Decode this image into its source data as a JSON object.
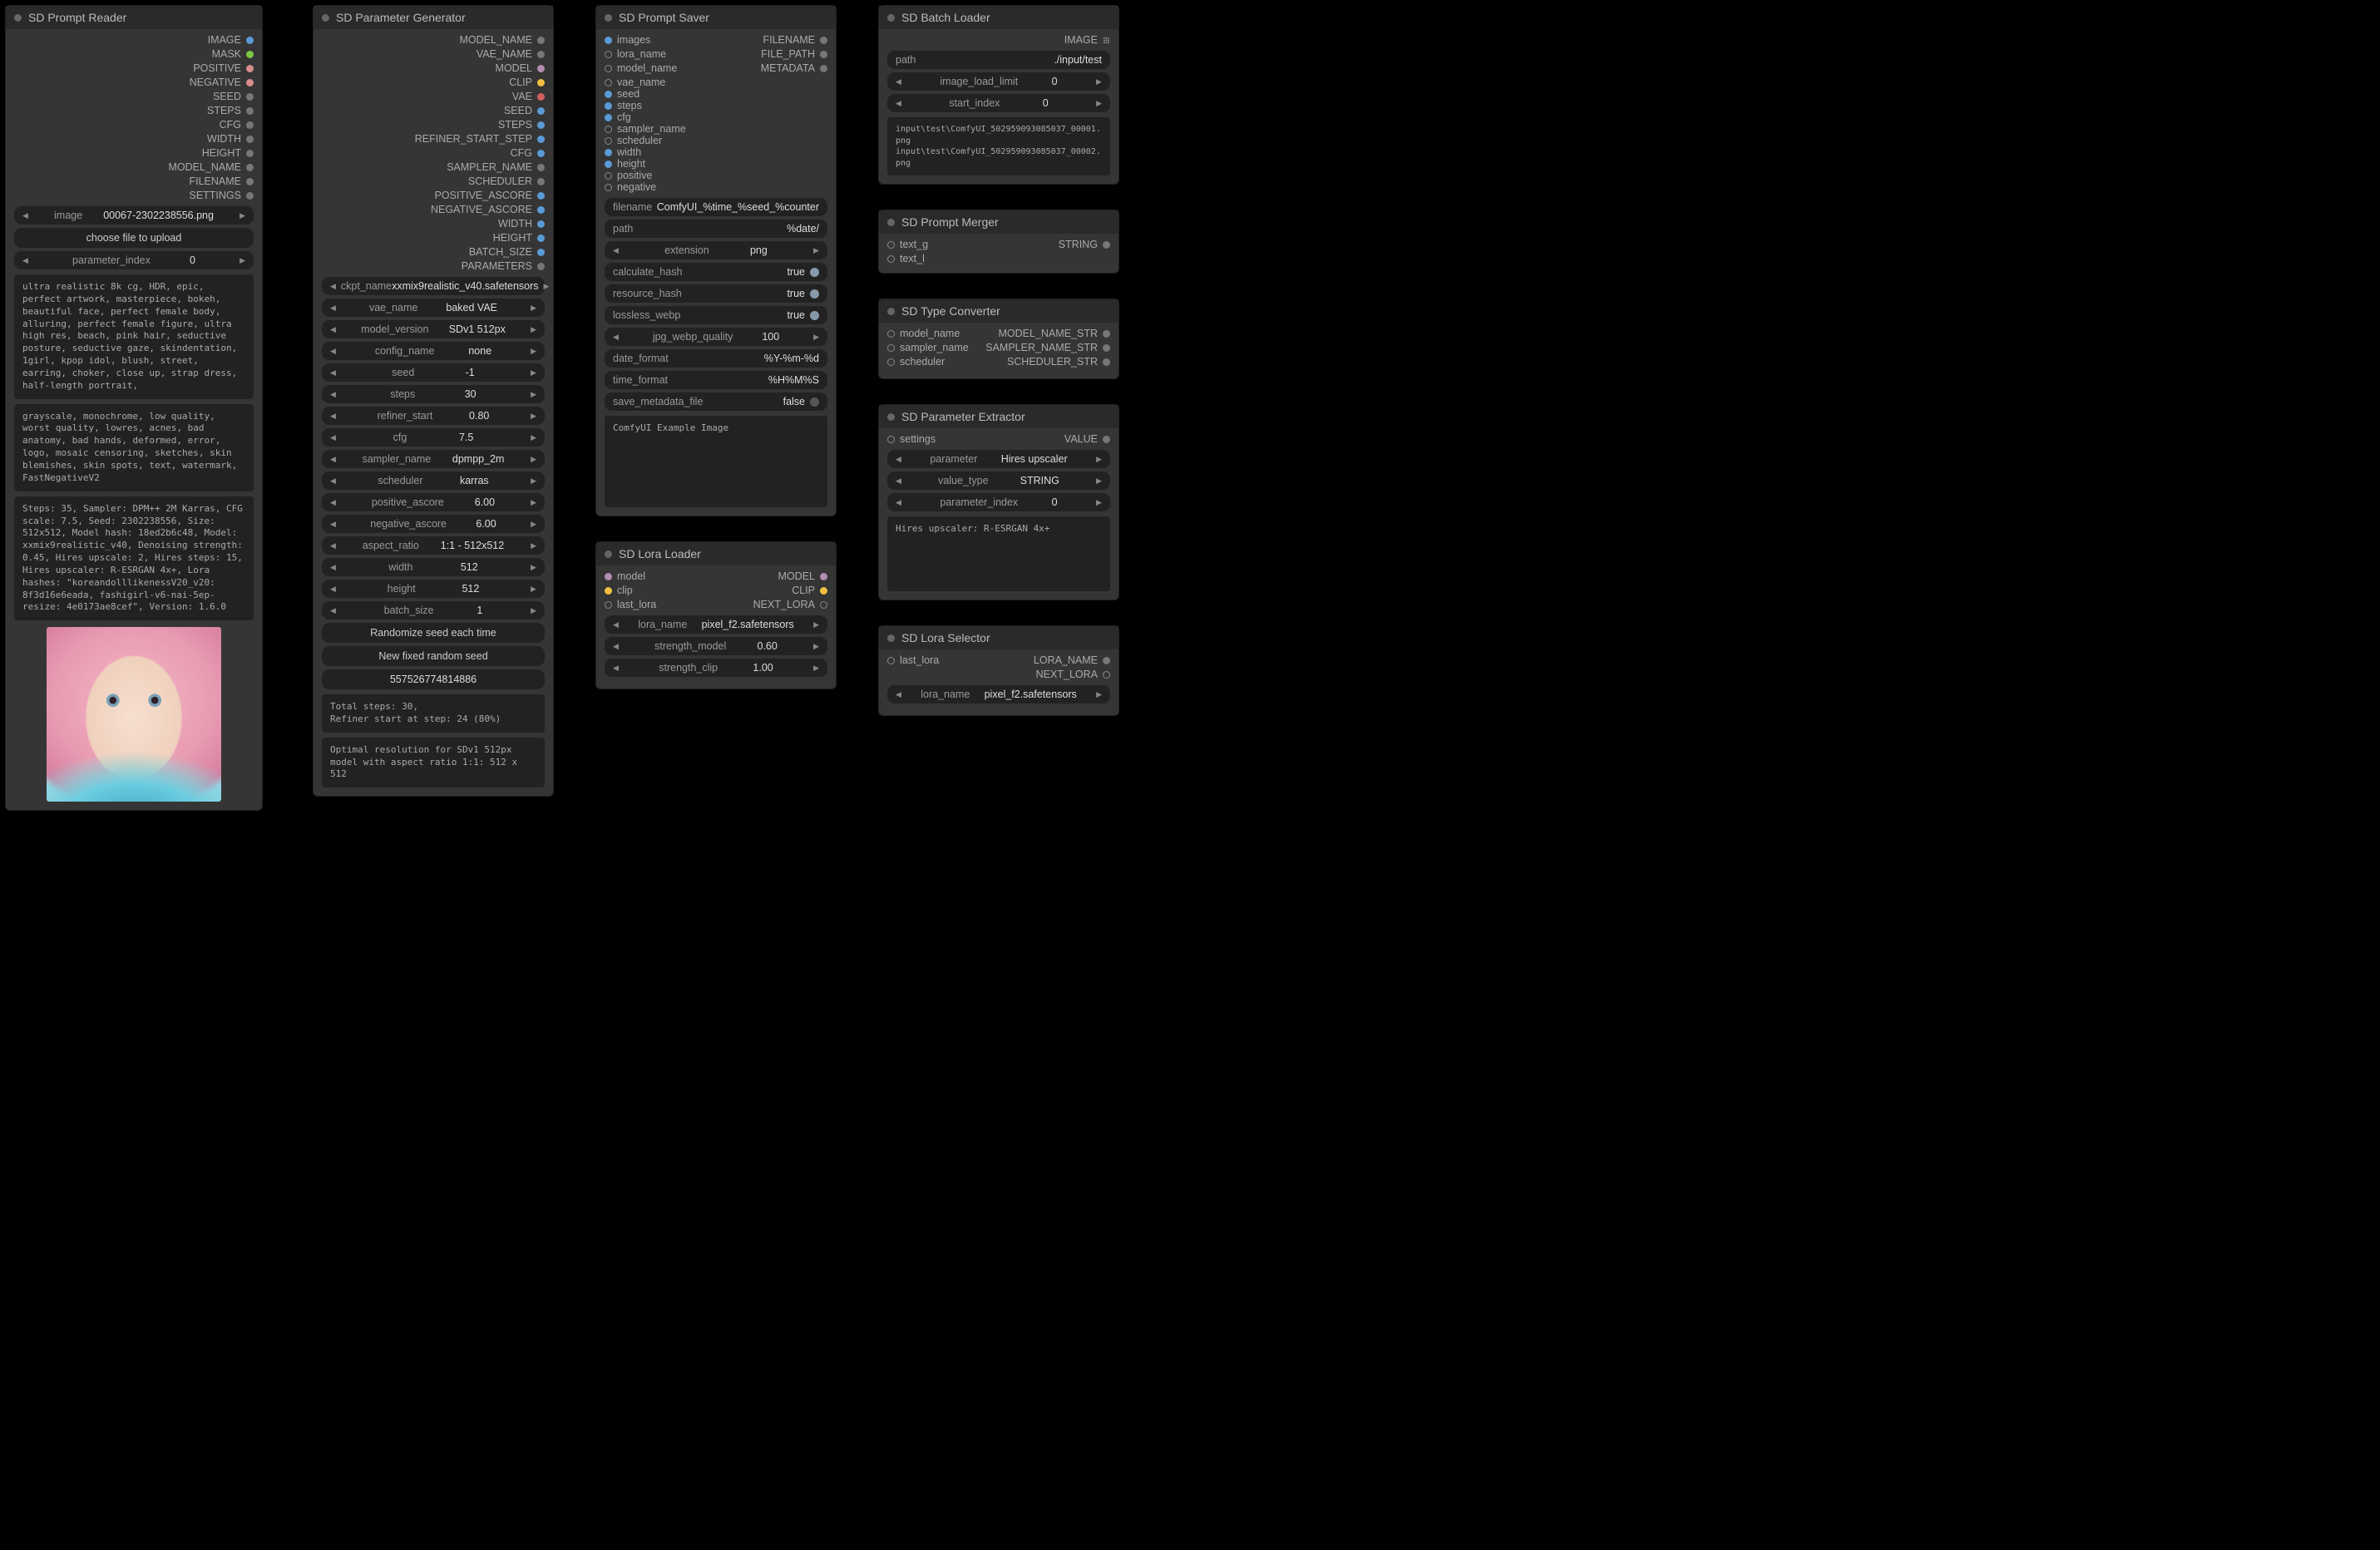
{
  "reader": {
    "title": "SD Prompt Reader",
    "outs": [
      "IMAGE",
      "MASK",
      "POSITIVE",
      "NEGATIVE",
      "SEED",
      "STEPS",
      "CFG",
      "WIDTH",
      "HEIGHT",
      "MODEL_NAME",
      "FILENAME",
      "SETTINGS"
    ],
    "image_widget": {
      "label": "image",
      "value": "00067-2302238556.png"
    },
    "upload_btn": "choose file to upload",
    "param_index": {
      "label": "parameter_index",
      "value": "0"
    },
    "positive": "ultra realistic 8k cg, HDR, epic, perfect artwork, masterpiece, bokeh, beautiful face, perfect female body, alluring, perfect female figure, ultra high res, beach, pink hair, seductive posture, seductive gaze, skindentation, 1girl, kpop idol, blush, street, earring, choker, close up, strap dress, half-length portrait,",
    "negative": "grayscale, monochrome, low quality, worst quality, lowres, acnes, bad anatomy, bad hands, deformed, error, logo, mosaic censoring, sketches, skin blemishes, skin spots, text, watermark, FastNegativeV2",
    "settings": "Steps: 35, Sampler: DPM++ 2M Karras, CFG scale: 7.5, Seed: 2302238556, Size: 512x512, Model hash: 18ed2b6c48, Model: xxmix9realistic_v40, Denoising strength: 0.45, Hires upscale: 2, Hires steps: 15, Hires upscaler: R-ESRGAN 4x+, Lora hashes: \"koreandolllikenessV20_v20: 8f3d16e6eada, fashigirl-v6-nai-5ep-resize: 4e0173ae8cef\", Version: 1.6.0"
  },
  "paramgen": {
    "title": "SD Parameter Generator",
    "outs": [
      "MODEL_NAME",
      "VAE_NAME",
      "MODEL",
      "CLIP",
      "VAE",
      "SEED",
      "STEPS",
      "REFINER_START_STEP",
      "CFG",
      "SAMPLER_NAME",
      "SCHEDULER",
      "POSITIVE_ASCORE",
      "NEGATIVE_ASCORE",
      "WIDTH",
      "HEIGHT",
      "BATCH_SIZE",
      "PARAMETERS"
    ],
    "widgets": [
      {
        "k": "ckpt_name",
        "v": "xxmix9realistic_v40.safetensors"
      },
      {
        "k": "vae_name",
        "v": "baked VAE"
      },
      {
        "k": "model_version",
        "v": "SDv1 512px"
      },
      {
        "k": "config_name",
        "v": "none"
      },
      {
        "k": "seed",
        "v": "-1"
      },
      {
        "k": "steps",
        "v": "30"
      },
      {
        "k": "refiner_start",
        "v": "0.80"
      },
      {
        "k": "cfg",
        "v": "7.5"
      },
      {
        "k": "sampler_name",
        "v": "dpmpp_2m"
      },
      {
        "k": "scheduler",
        "v": "karras"
      },
      {
        "k": "positive_ascore",
        "v": "6.00"
      },
      {
        "k": "negative_ascore",
        "v": "6.00"
      },
      {
        "k": "aspect_ratio",
        "v": "1:1 - 512x512"
      },
      {
        "k": "width",
        "v": "512"
      },
      {
        "k": "height",
        "v": "512"
      },
      {
        "k": "batch_size",
        "v": "1"
      }
    ],
    "btn1": "Randomize seed each time",
    "btn2": "New fixed random seed",
    "seed_disp": "557526774814886",
    "info1": "Total steps: 30,\nRefiner start at step: 24 (80%)",
    "info2": "Optimal resolution for SDv1 512px model with aspect ratio 1:1: 512 x 512"
  },
  "saver": {
    "title": "SD Prompt Saver",
    "ins": [
      "images",
      "lora_name",
      "model_name",
      "vae_name",
      "seed",
      "steps",
      "cfg",
      "sampler_name",
      "scheduler",
      "width",
      "height",
      "positive",
      "negative"
    ],
    "outs": [
      "FILENAME",
      "FILE_PATH",
      "METADATA"
    ],
    "filename": {
      "k": "filename",
      "v": "ComfyUI_%time_%seed_%counter"
    },
    "path": {
      "k": "path",
      "v": "%date/"
    },
    "extension": {
      "k": "extension",
      "v": "png"
    },
    "calc_hash": {
      "k": "calculate_hash",
      "v": "true",
      "on": true
    },
    "res_hash": {
      "k": "resource_hash",
      "v": "true",
      "on": true
    },
    "lossless": {
      "k": "lossless_webp",
      "v": "true",
      "on": true
    },
    "quality": {
      "k": "jpg_webp_quality",
      "v": "100"
    },
    "date_format": {
      "k": "date_format",
      "v": "%Y-%m-%d"
    },
    "time_format": {
      "k": "time_format",
      "v": "%H%M%S"
    },
    "save_meta": {
      "k": "save_metadata_file",
      "v": "false",
      "on": false
    },
    "text": "ComfyUI Example Image"
  },
  "loraLoader": {
    "title": "SD Lora Loader",
    "in": [
      {
        "n": "model",
        "c": "d-purple"
      },
      {
        "n": "clip",
        "c": "d-yellow"
      },
      {
        "n": "last_lora",
        "c": "d-empty"
      }
    ],
    "out": [
      {
        "n": "MODEL",
        "c": "d-purple"
      },
      {
        "n": "CLIP",
        "c": "d-yellow"
      },
      {
        "n": "NEXT_LORA",
        "c": "d-empty"
      }
    ],
    "w": [
      {
        "k": "lora_name",
        "v": "pixel_f2.safetensors"
      },
      {
        "k": "strength_model",
        "v": "0.60"
      },
      {
        "k": "strength_clip",
        "v": "1.00"
      }
    ]
  },
  "batch": {
    "title": "SD Batch Loader",
    "out": "IMAGE",
    "path": {
      "k": "path",
      "v": "./input/test"
    },
    "limit": {
      "k": "image_load_limit",
      "v": "0"
    },
    "start": {
      "k": "start_index",
      "v": "0"
    },
    "list": "input\\test\\ComfyUI_502959093085037_00001.png\ninput\\test\\ComfyUI_502959093085037_00002.png"
  },
  "merger": {
    "title": "SD Prompt Merger",
    "in": [
      "text_g",
      "text_l"
    ],
    "out": "STRING"
  },
  "typeconv": {
    "title": "SD Type Converter",
    "rows": [
      {
        "in": "model_name",
        "out": "MODEL_NAME_STR"
      },
      {
        "in": "sampler_name",
        "out": "SAMPLER_NAME_STR"
      },
      {
        "in": "scheduler",
        "out": "SCHEDULER_STR"
      }
    ]
  },
  "extractor": {
    "title": "SD Parameter Extractor",
    "in": "settings",
    "out": "VALUE",
    "w": [
      {
        "k": "parameter",
        "v": "Hires upscaler"
      },
      {
        "k": "value_type",
        "v": "STRING"
      },
      {
        "k": "parameter_index",
        "v": "0"
      }
    ],
    "text": "Hires upscaler: R-ESRGAN 4x+"
  },
  "loraSel": {
    "title": "SD Lora Selector",
    "in": "last_lora",
    "out": [
      "LORA_NAME",
      "NEXT_LORA"
    ],
    "w": {
      "k": "lora_name",
      "v": "pixel_f2.safetensors"
    }
  }
}
